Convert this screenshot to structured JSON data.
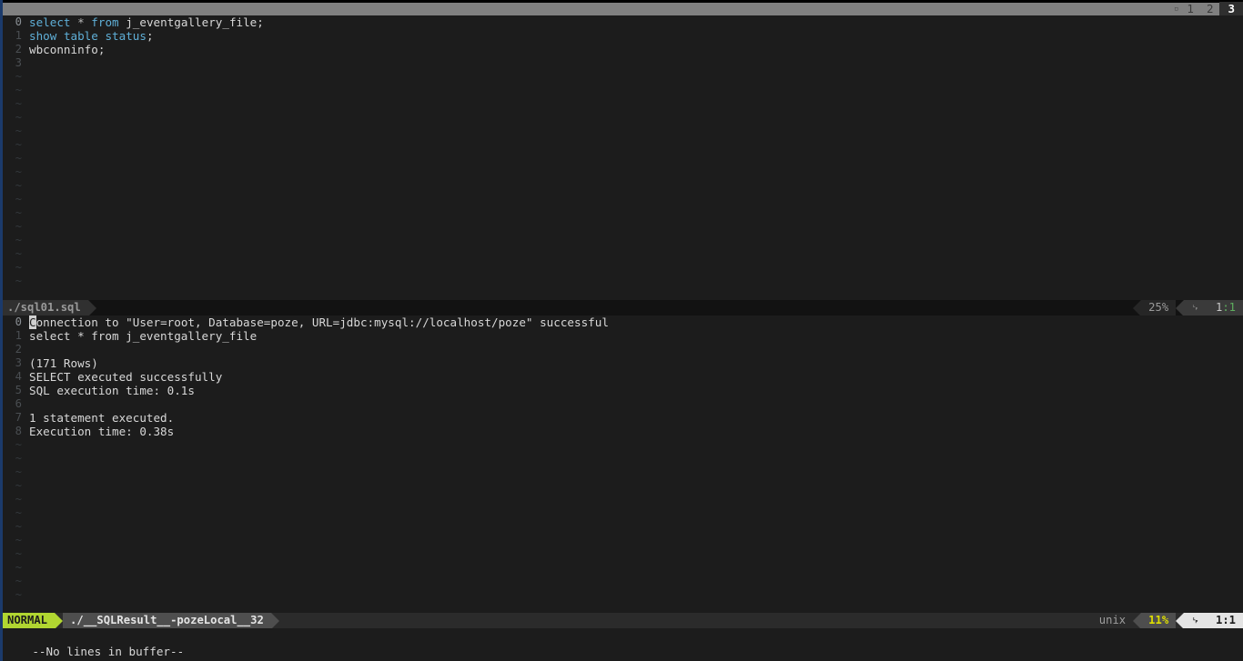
{
  "app": {
    "name": "vim",
    "colors": {
      "background": "#1c1c1c",
      "tabline_bg": "#808080",
      "mode_accent": "#b1d631",
      "keyword": "#5fafd7",
      "percent_accent": "#dfdf00",
      "edge_strip": "#1b3a6b"
    }
  },
  "tabline": {
    "mark_icon": "buffer-marker-icon",
    "mark_glyph": "▫",
    "tabs": [
      {
        "label": "1",
        "active": false
      },
      {
        "label": "2",
        "active": false
      },
      {
        "label": "3",
        "active": true
      }
    ]
  },
  "editor": {
    "filename": "./sql01.sql",
    "lines": [
      {
        "num": "0",
        "current": true,
        "tokens": [
          {
            "t": "select",
            "c": "kw"
          },
          {
            "t": " ",
            "c": "ltxt"
          },
          {
            "t": "*",
            "c": "star"
          },
          {
            "t": " ",
            "c": "ltxt"
          },
          {
            "t": "from",
            "c": "kw"
          },
          {
            "t": " j_eventgallery_file",
            "c": "ltxt"
          },
          {
            "t": ";",
            "c": "punct"
          }
        ]
      },
      {
        "num": "1",
        "current": false,
        "tokens": [
          {
            "t": "show",
            "c": "kw"
          },
          {
            "t": " ",
            "c": "ltxt"
          },
          {
            "t": "table",
            "c": "kw"
          },
          {
            "t": " ",
            "c": "ltxt"
          },
          {
            "t": "status",
            "c": "kw"
          },
          {
            "t": ";",
            "c": "punct"
          }
        ]
      },
      {
        "num": "2",
        "current": false,
        "tokens": [
          {
            "t": "wbconninfo",
            "c": "ltxt"
          },
          {
            "t": ";",
            "c": "punct"
          }
        ]
      },
      {
        "num": "3",
        "current": false,
        "tokens": []
      }
    ],
    "filler_rows": 16,
    "filler_glyph": "~"
  },
  "editor_status": {
    "filename": "./sql01.sql",
    "percent": "25%",
    "line_icon": "line-number-icon",
    "line_icon_glyph": "␊",
    "position_line": "1",
    "position_sep": ":",
    "position_col": "1"
  },
  "result": {
    "cursor_char": "C",
    "lines": [
      {
        "num": "0",
        "text": "onnection to \"User=root, Database=poze, URL=jdbc:mysql://localhost/poze\" successful",
        "cursor": true
      },
      {
        "num": "1",
        "text": "select * from j_eventgallery_file",
        "cursor": false
      },
      {
        "num": "2",
        "text": "",
        "cursor": false
      },
      {
        "num": "3",
        "text": "(171 Rows)",
        "cursor": false
      },
      {
        "num": "4",
        "text": "SELECT executed successfully",
        "cursor": false
      },
      {
        "num": "5",
        "text": "SQL execution time: 0.1s",
        "cursor": false
      },
      {
        "num": "6",
        "text": "",
        "cursor": false
      },
      {
        "num": "7",
        "text": "1 statement executed.",
        "cursor": false
      },
      {
        "num": "8",
        "text": "Execution time: 0.38s",
        "cursor": false
      }
    ],
    "filler_rows": 12,
    "filler_glyph": "~"
  },
  "result_status": {
    "mode": "NORMAL",
    "filename": "./__SQLResult__-pozeLocal__32",
    "fileformat": "unix",
    "percent": "11%",
    "line_icon": "line-number-icon",
    "line_icon_glyph": "␊",
    "position_line": "1",
    "position_sep": ":",
    "position_col": "1"
  },
  "cmdline": {
    "message": "--No lines in buffer--"
  }
}
